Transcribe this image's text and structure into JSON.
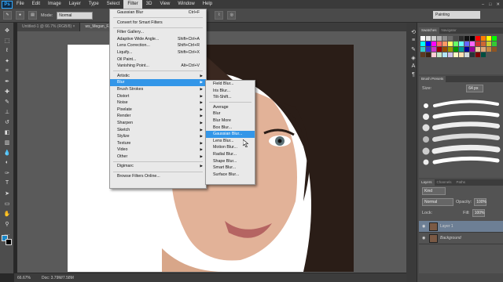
{
  "menubar": {
    "logo": "Ps",
    "items": [
      "File",
      "Edit",
      "Image",
      "Layer",
      "Type",
      "Select",
      "Filter",
      "3D",
      "View",
      "Window",
      "Help"
    ],
    "active_index": 6
  },
  "window_controls": {
    "min": "–",
    "max": "□",
    "close": "✕"
  },
  "options_bar": {
    "mode_label": "Mode:",
    "mode_value": "Normal",
    "workspace": "Painting"
  },
  "tabs": [
    {
      "label": "Untitled-1 @ 66.7% (RGB/8) ×",
      "active": false
    },
    {
      "label": "ws_Megan_F...",
      "active": true
    }
  ],
  "status": {
    "zoom": "66.67%",
    "doc": "Doc: 3.79M/7.58M"
  },
  "filter_menu": [
    {
      "label": "Gaussian Blur",
      "shortcut": "Ctrl+F"
    },
    {
      "sep": true
    },
    {
      "label": "Convert for Smart Filters"
    },
    {
      "sep": true
    },
    {
      "label": "Filter Gallery..."
    },
    {
      "label": "Adaptive Wide Angle...",
      "shortcut": "Shift+Ctrl+A"
    },
    {
      "label": "Lens Correction...",
      "shortcut": "Shift+Ctrl+R"
    },
    {
      "label": "Liquify...",
      "shortcut": "Shift+Ctrl+X"
    },
    {
      "label": "Oil Paint..."
    },
    {
      "label": "Vanishing Point...",
      "shortcut": "Alt+Ctrl+V"
    },
    {
      "sep": true
    },
    {
      "label": "Artistic",
      "sub": true
    },
    {
      "label": "Blur",
      "sub": true,
      "hl": true
    },
    {
      "label": "Brush Strokes",
      "sub": true
    },
    {
      "label": "Distort",
      "sub": true
    },
    {
      "label": "Noise",
      "sub": true
    },
    {
      "label": "Pixelate",
      "sub": true
    },
    {
      "label": "Render",
      "sub": true
    },
    {
      "label": "Sharpen",
      "sub": true
    },
    {
      "label": "Sketch",
      "sub": true
    },
    {
      "label": "Stylize",
      "sub": true
    },
    {
      "label": "Texture",
      "sub": true
    },
    {
      "label": "Video",
      "sub": true
    },
    {
      "label": "Other",
      "sub": true
    },
    {
      "sep": true
    },
    {
      "label": "Digimarc",
      "sub": true
    },
    {
      "sep": true
    },
    {
      "label": "Browse Filters Online..."
    }
  ],
  "blur_menu": [
    {
      "label": "Field Blur..."
    },
    {
      "label": "Iris Blur..."
    },
    {
      "label": "Tilt-Shift..."
    },
    {
      "sep": true
    },
    {
      "label": "Average"
    },
    {
      "label": "Blur"
    },
    {
      "label": "Blur More"
    },
    {
      "label": "Box Blur..."
    },
    {
      "label": "Gaussian Blur...",
      "hl": true
    },
    {
      "label": "Lens Blur..."
    },
    {
      "label": "Motion Blur..."
    },
    {
      "label": "Radial Blur..."
    },
    {
      "label": "Shape Blur..."
    },
    {
      "label": "Smart Blur..."
    },
    {
      "label": "Surface Blur..."
    }
  ],
  "swatches_panel": {
    "tabs": [
      "Swatches",
      "Navigator"
    ],
    "colors": [
      "#ffffff",
      "#e5e5e5",
      "#cfcfcf",
      "#b0b0b0",
      "#8e8e8e",
      "#6b6b6b",
      "#4a4a4a",
      "#2c2c2c",
      "#111111",
      "#000000",
      "#ff0000",
      "#ff7f00",
      "#ffff00",
      "#00ff00",
      "#00ffff",
      "#0000ff",
      "#ff00ff",
      "#ff6666",
      "#ff9966",
      "#ffff66",
      "#66ff66",
      "#66ffff",
      "#6666ff",
      "#ff66ff",
      "#cc3333",
      "#cc6633",
      "#cccc33",
      "#33cc33",
      "#33cccc",
      "#3333cc",
      "#cc33cc",
      "#990000",
      "#994c00",
      "#999900",
      "#009900",
      "#009999",
      "#000099",
      "#990099",
      "#f2c9a0",
      "#e0a677",
      "#c68642",
      "#8d5524",
      "#5c3a21",
      "#3d2314",
      "#ffccd5",
      "#c8e6c9",
      "#b3e5fc",
      "#d1c4e9",
      "#fff9c4",
      "#ffe0b2",
      "#cfd8dc",
      "#263238",
      "#7f0000",
      "#004d40"
    ]
  },
  "brush_panel": {
    "title": "Brush Presets",
    "size_label": "Size:",
    "size_value": "64 px"
  },
  "layers_panel": {
    "tabs": [
      "Layers",
      "Channels",
      "Paths"
    ],
    "kind": "Kind",
    "blend": "Normal",
    "opacity_label": "Opacity:",
    "opacity_value": "100%",
    "lock_label": "Lock:",
    "fill_label": "Fill:",
    "fill_value": "100%",
    "layers": [
      {
        "name": "Layer 1",
        "selected": true
      },
      {
        "name": "Background",
        "selected": false
      }
    ]
  },
  "tools": [
    "move-icon",
    "marquee-icon",
    "lasso-icon",
    "quick-select-icon",
    "crop-icon",
    "eyedropper-icon",
    "healing-icon",
    "brush-icon",
    "stamp-icon",
    "history-brush-icon",
    "eraser-icon",
    "gradient-icon",
    "blur-tool-icon",
    "dodge-icon",
    "pen-icon",
    "type-icon",
    "path-select-icon",
    "shape-icon",
    "hand-icon",
    "zoom-icon",
    "more-icon"
  ]
}
